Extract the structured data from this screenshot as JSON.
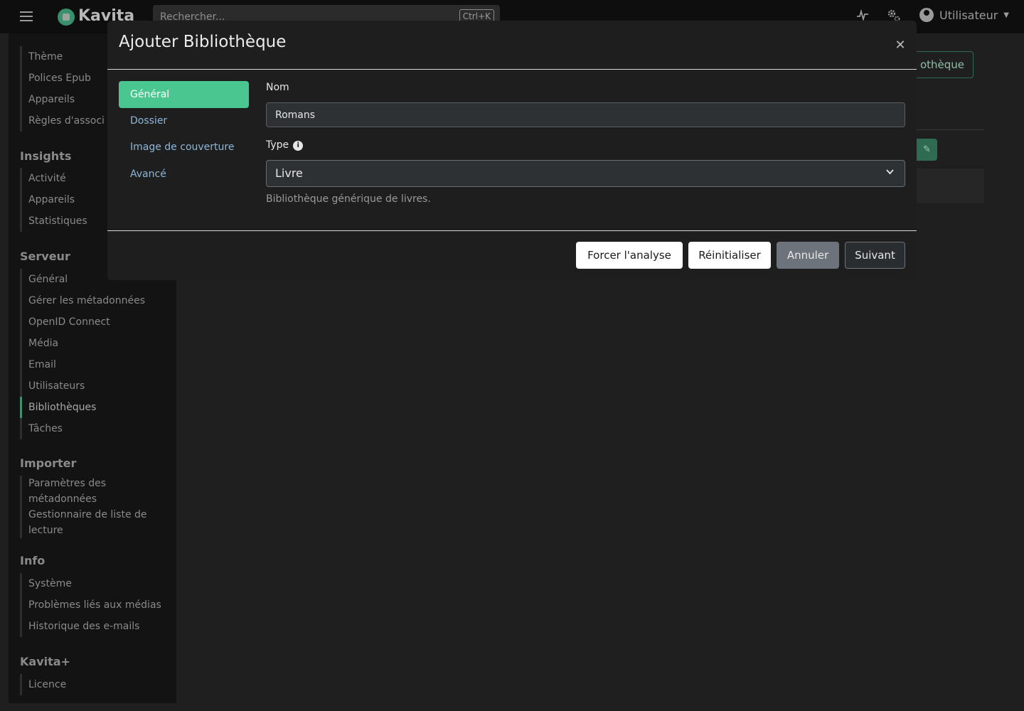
{
  "topnav": {
    "brand": "Kavita",
    "search_placeholder": "Rechercher...",
    "search_shortcut": "Ctrl+K",
    "user_label": "Utilisateur"
  },
  "sidebar": {
    "top_items": [
      "Thème",
      "Polices Epub",
      "Appareils",
      "Règles d'associ"
    ],
    "sections": [
      {
        "title": "Insights",
        "items": [
          "Activité",
          "Appareils",
          "Statistiques"
        ]
      },
      {
        "title": "Serveur",
        "items": [
          "Général",
          "Gérer les métadonnées",
          "OpenID Connect",
          "Média",
          "Email",
          "Utilisateurs",
          "Bibliothèques",
          "Tâches"
        ]
      },
      {
        "title": "Importer",
        "items": [
          "Paramètres des métadonnées",
          "Gestionnaire de liste de lecture"
        ]
      },
      {
        "title": "Info",
        "items": [
          "Système",
          "Problèmes liés aux médias",
          "Historique des e-mails"
        ]
      },
      {
        "title": "Kavita+",
        "items": [
          "Licence"
        ]
      }
    ],
    "active_item": "Bibliothèques"
  },
  "background": {
    "library_button_label": "othèque"
  },
  "modal": {
    "title": "Ajouter Bibliothèque",
    "tabs": [
      "Général",
      "Dossier",
      "Image de couverture",
      "Avancé"
    ],
    "active_tab": "Général",
    "name_label": "Nom",
    "name_value": "Romans",
    "type_label": "Type",
    "type_value": "Livre",
    "type_help": "Bibliothèque générique de livres.",
    "buttons": {
      "force_scan": "Forcer l'analyse",
      "reset": "Réinitialiser",
      "cancel": "Annuler",
      "next": "Suivant"
    }
  },
  "colors": {
    "accent": "#4ac690",
    "sidebar_active_bar": "#3d8f6d",
    "modal_bg": "#1e1e1e"
  }
}
